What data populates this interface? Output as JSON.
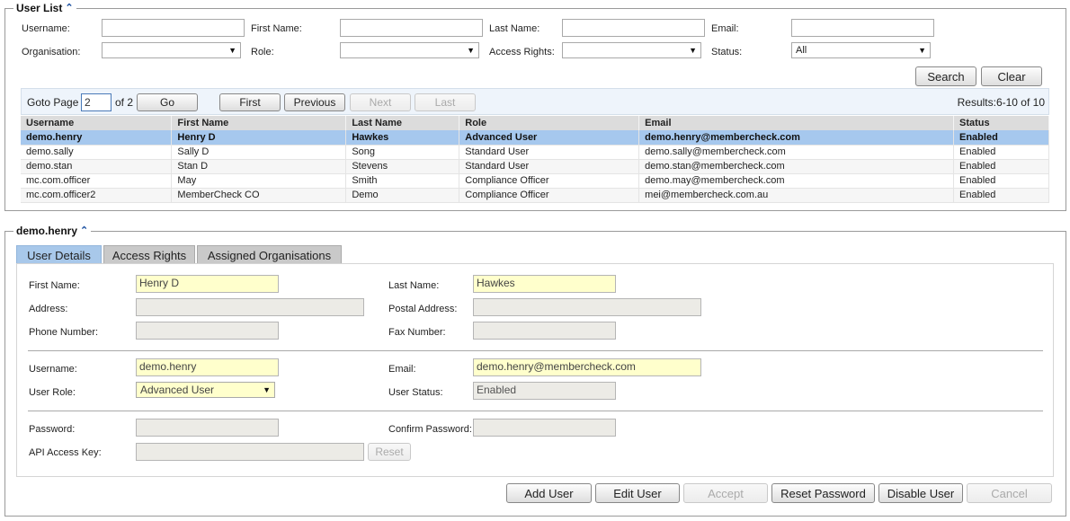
{
  "user_list": {
    "title": "User List",
    "filters": {
      "username_label": "Username:",
      "first_name_label": "First Name:",
      "last_name_label": "Last Name:",
      "email_label": "Email:",
      "organisation_label": "Organisation:",
      "role_label": "Role:",
      "access_rights_label": "Access Rights:",
      "status_label": "Status:",
      "status_value": "All"
    },
    "search_label": "Search",
    "clear_label": "Clear",
    "pager": {
      "goto_label": "Goto Page",
      "page_value": "2",
      "of_label": "of 2",
      "go_label": "Go",
      "first_label": "First",
      "previous_label": "Previous",
      "next_label": "Next",
      "last_label": "Last",
      "results": "Results:6-10 of 10"
    },
    "columns": [
      "Username",
      "First Name",
      "Last Name",
      "Role",
      "Email",
      "Status"
    ],
    "rows": [
      [
        "demo.henry",
        "Henry D",
        "Hawkes",
        "Advanced User",
        "demo.henry@membercheck.com",
        "Enabled"
      ],
      [
        "demo.sally",
        "Sally D",
        "Song",
        "Standard User",
        "demo.sally@membercheck.com",
        "Enabled"
      ],
      [
        "demo.stan",
        "Stan D",
        "Stevens",
        "Standard User",
        "demo.stan@membercheck.com",
        "Enabled"
      ],
      [
        "mc.com.officer",
        "May",
        "Smith",
        "Compliance Officer",
        "demo.may@membercheck.com",
        "Enabled"
      ],
      [
        "mc.com.officer2",
        "MemberCheck CO",
        "Demo",
        "Compliance Officer",
        "mei@membercheck.com.au",
        "Enabled"
      ]
    ]
  },
  "detail": {
    "title": "demo.henry",
    "tabs": [
      "User Details",
      "Access Rights",
      "Assigned Organisations"
    ],
    "first_name_label": "First Name:",
    "first_name_value": "Henry D",
    "last_name_label": "Last Name:",
    "last_name_value": "Hawkes",
    "address_label": "Address:",
    "postal_address_label": "Postal Address:",
    "phone_label": "Phone Number:",
    "fax_label": "Fax Number:",
    "username_label": "Username:",
    "username_value": "demo.henry",
    "email_label": "Email:",
    "email_value": "demo.henry@membercheck.com",
    "user_role_label": "User Role:",
    "user_role_value": "Advanced User",
    "user_status_label": "User Status:",
    "user_status_value": "Enabled",
    "password_label": "Password:",
    "confirm_password_label": "Confirm Password:",
    "api_key_label": "API Access Key:",
    "reset_label": "Reset",
    "actions": {
      "add_user": "Add User",
      "edit_user": "Edit User",
      "accept": "Accept",
      "reset_password": "Reset Password",
      "disable_user": "Disable User",
      "cancel": "Cancel"
    }
  },
  "colors": {
    "selected_row": "#a6c8ee",
    "active_tab": "#a8c8ea",
    "readonly_highlight": "#ffffcc",
    "collapse_icon": "#1a4fa0"
  }
}
